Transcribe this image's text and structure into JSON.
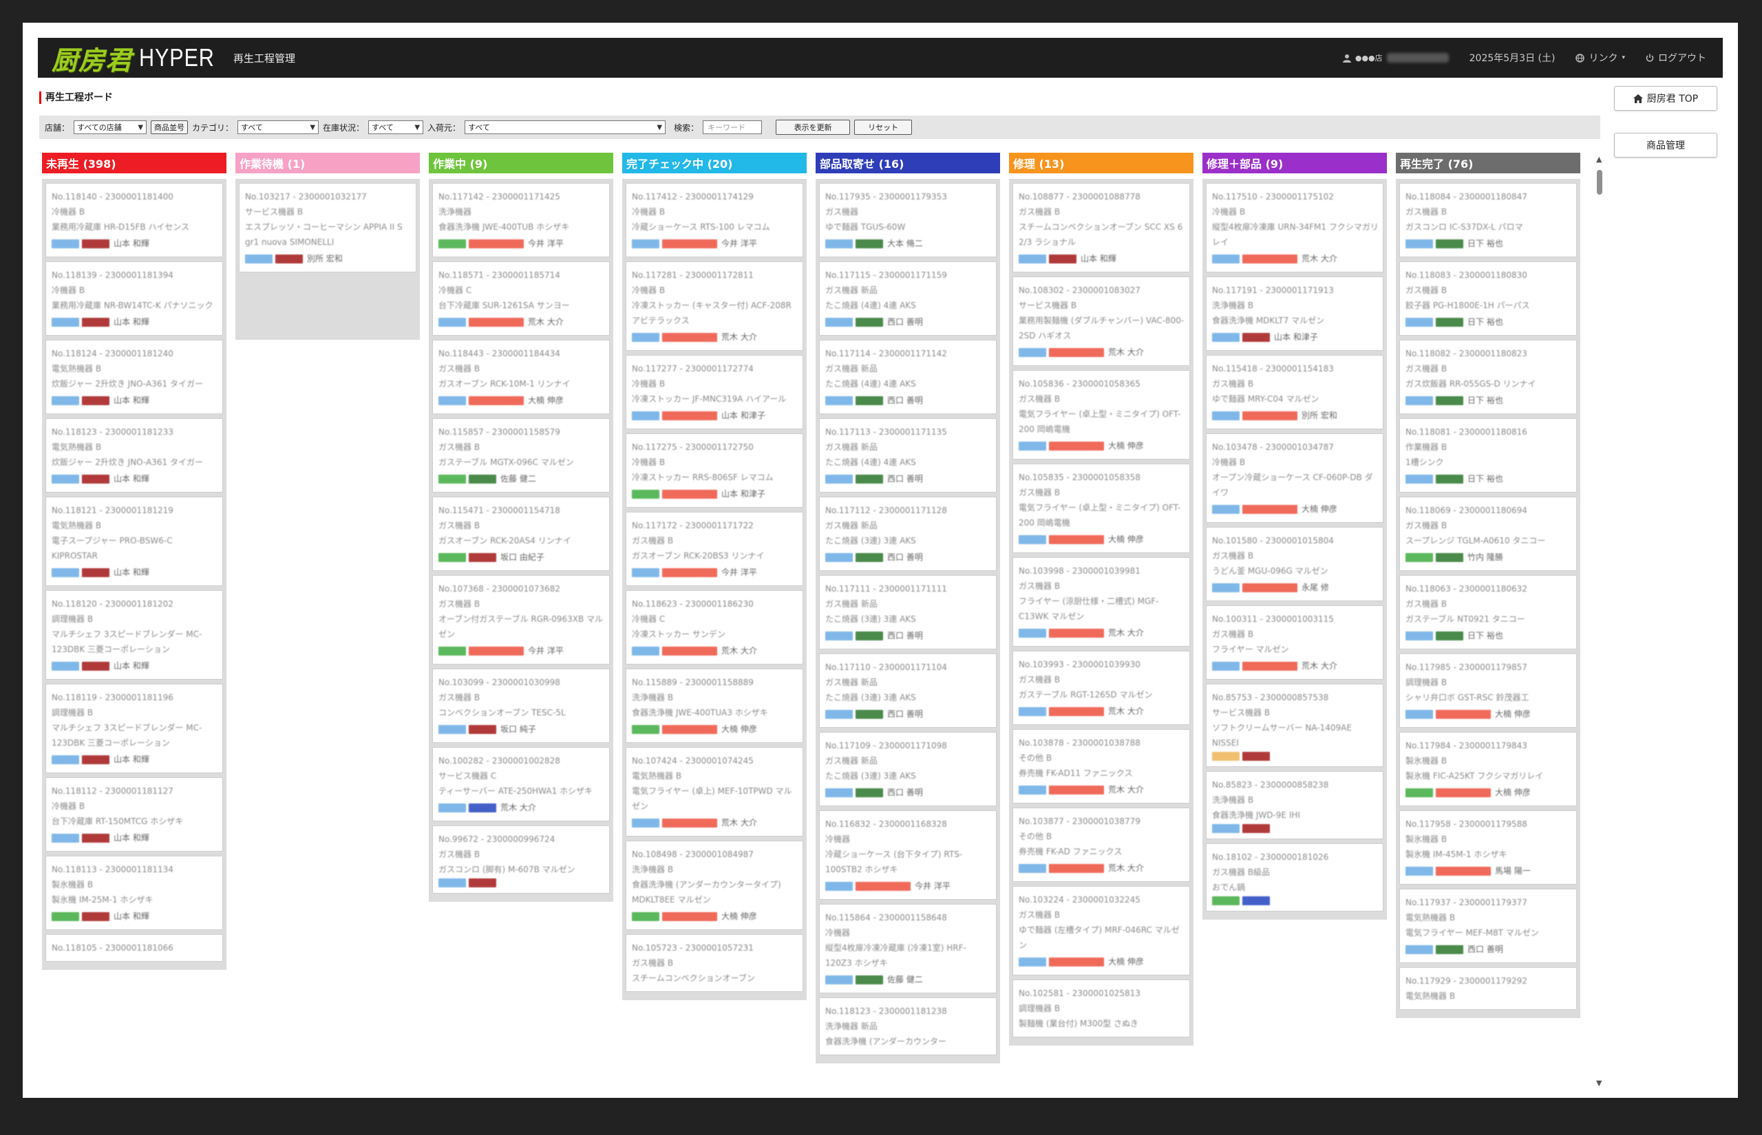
{
  "header": {
    "logo_mark": "厨房君",
    "logo_hyper": "HYPER",
    "app_title": "再生工程管理",
    "user_store": "●●●店",
    "date": "2025年5月3日 (土)",
    "link_label": "リンク",
    "logout_label": "ログアウト",
    "bg_color": "#1e1e1e",
    "logo_color": "#9ccc20"
  },
  "page_title": "再生工程ボード",
  "side_buttons": {
    "top_label": "厨房君 TOP",
    "products_label": "商品管理"
  },
  "filters": {
    "store_label": "店舗：",
    "store_value": "すべての店舗",
    "product_order_button": "商品並号",
    "category_label": "カテゴリ：",
    "category_value": "すべて",
    "stock_label": "在庫状況：",
    "stock_value": "すべて",
    "arrival_label": "入荷元：",
    "arrival_value": "すべて",
    "search_label": "検索：",
    "search_placeholder": "キーワード",
    "apply_button": "表示を更新",
    "reset_button": "リセット"
  },
  "tag_colors": {
    "blue": "#7fb8e8",
    "red": "#b03a3a",
    "salmon": "#f06a5a",
    "green": "#5cb85c",
    "darkgreen": "#4a8a4a",
    "navy": "#4460c8",
    "orange": "#f0c070"
  },
  "columns": [
    {
      "title": "未再生 (398)",
      "color": "#ee1c24",
      "cards": [
        {
          "no": "No.118140 - 2300001181400",
          "cat": "冷機器 B",
          "name": "業務用冷蔵庫 HR-D15FB ハイセンス",
          "tags": [
            "blue",
            "red"
          ],
          "person": "山本 和輝"
        },
        {
          "no": "No.118139 - 2300001181394",
          "cat": "冷機器 B",
          "name": "業務用冷蔵庫 NR-BW14TC-K パナソニック",
          "tags": [
            "blue",
            "red"
          ],
          "person": "山本 和輝"
        },
        {
          "no": "No.118124 - 2300001181240",
          "cat": "電気熱機器 B",
          "name": "炊飯ジャー 2升炊き JNO-A361 タイガー",
          "tags": [
            "blue",
            "red"
          ],
          "person": "山本 和輝"
        },
        {
          "no": "No.118123 - 2300001181233",
          "cat": "電気熱機器 B",
          "name": "炊飯ジャー 2升炊き JNO-A361 タイガー",
          "tags": [
            "blue",
            "red"
          ],
          "person": "山本 和輝"
        },
        {
          "no": "No.118121 - 2300001181219",
          "cat": "電気熱機器 B",
          "name": "電子スープジャー PRO-BSW6-C KIPROSTAR",
          "tags": [
            "blue",
            "red"
          ],
          "person": "山本 和輝"
        },
        {
          "no": "No.118120 - 2300001181202",
          "cat": "調理機器 B",
          "name": "マルチシェフ 3スピードブレンダー MC-123DBK 三菱コーポレーション",
          "tags": [
            "blue",
            "red"
          ],
          "person": "山本 和輝"
        },
        {
          "no": "No.118119 - 2300001181196",
          "cat": "調理機器 B",
          "name": "マルチシェフ 3スピードブレンダー MC-123DBK 三菱コーポレーション",
          "tags": [
            "blue",
            "red"
          ],
          "person": "山本 和輝"
        },
        {
          "no": "No.118112 - 2300001181127",
          "cat": "冷機器 B",
          "name": "台下冷蔵庫 RT-150MTCG ホシザキ",
          "tags": [
            "blue",
            "red"
          ],
          "person": "山本 和輝"
        },
        {
          "no": "No.118113 - 2300001181134",
          "cat": "製氷機器 B",
          "name": "製氷機 IM-25M-1 ホシザキ",
          "tags": [
            "green",
            "red"
          ],
          "person": "山本 和輝"
        },
        {
          "no": "No.118105 - 2300001181066",
          "cat": "",
          "name": "",
          "tags": [],
          "person": ""
        }
      ]
    },
    {
      "title": "作業待機 (1)",
      "color": "#f7a1c4",
      "cards": [
        {
          "no": "No.103217 - 2300001032177",
          "cat": "サービス機器 B",
          "name": "エスプレッソ・コーヒーマシン APPIA II S gr1 nuova SIMONELLI",
          "tags": [
            "blue",
            "red"
          ],
          "person": "別所 宏和"
        }
      ]
    },
    {
      "title": "作業中 (9)",
      "color": "#6ec43c",
      "cards": [
        {
          "no": "No.117142 - 2300001171425",
          "cat": "洗浄機器",
          "name": "食器洗浄機 JWE-400TUB ホシザキ",
          "tags": [
            "green",
            "salmon"
          ],
          "person": "今井 洋平"
        },
        {
          "no": "No.118571 - 2300001185714",
          "cat": "冷機器 C",
          "name": "台下冷蔵庫 SUR-1261SA サンヨー",
          "tags": [
            "blue",
            "salmon"
          ],
          "person": "荒木 大介"
        },
        {
          "no": "No.118443 - 2300001184434",
          "cat": "ガス機器 B",
          "name": "ガスオーブン RCK-10M-1 リンナイ",
          "tags": [
            "blue",
            "salmon"
          ],
          "person": "大楠 伸彦"
        },
        {
          "no": "No.115857 - 2300001158579",
          "cat": "ガス機器 B",
          "name": "ガステーブル MGTX-096C マルゼン",
          "tags": [
            "green",
            "darkgreen"
          ],
          "person": "佐藤 健二"
        },
        {
          "no": "No.115471 - 2300001154718",
          "cat": "ガス機器 B",
          "name": "ガスオーブン RCK-20AS4 リンナイ",
          "tags": [
            "green",
            "red"
          ],
          "person": "坂口 由紀子"
        },
        {
          "no": "No.107368 - 2300001073682",
          "cat": "ガス機器 B",
          "name": "オーブン付ガステーブル RGR-0963XB マルゼン",
          "tags": [
            "green",
            "salmon"
          ],
          "person": "今井 洋平"
        },
        {
          "no": "No.103099 - 2300001030998",
          "cat": "ガス機器 B",
          "name": "コンベクションオーブン TESC-5L",
          "tags": [
            "blue",
            "red"
          ],
          "person": "坂口 純子"
        },
        {
          "no": "No.100282 - 2300001002828",
          "cat": "サービス機器 C",
          "name": "ティーサーバー ATE-250HWA1 ホシザキ",
          "tags": [
            "blue",
            "navy"
          ],
          "person": "荒木 大介"
        },
        {
          "no": "No.99672 - 2300000996724",
          "cat": "ガス機器 B",
          "name": "ガスコンロ (脚有) M-607B マルゼン",
          "tags": [
            "blue",
            "red"
          ],
          "person": ""
        }
      ]
    },
    {
      "title": "完了チェック中 (20)",
      "color": "#22b8e8",
      "cards": [
        {
          "no": "No.117412 - 2300001174129",
          "cat": "冷機器 B",
          "name": "冷蔵ショーケース RTS-100 レマコム",
          "tags": [
            "blue",
            "salmon"
          ],
          "person": "今井 洋平"
        },
        {
          "no": "No.117281 - 2300001172811",
          "cat": "冷機器 B",
          "name": "冷凍ストッカー (キャスター付) ACF-208R アビテラックス",
          "tags": [
            "blue",
            "salmon"
          ],
          "person": "荒木 大介"
        },
        {
          "no": "No.117277 - 2300001172774",
          "cat": "冷機器 B",
          "name": "冷凍ストッカー JF-MNC319A ハイアール",
          "tags": [
            "blue",
            "salmon"
          ],
          "person": "山本 和津子"
        },
        {
          "no": "No.117275 - 2300001172750",
          "cat": "冷機器 B",
          "name": "冷凍ストッカー RRS-806SF レマコム",
          "tags": [
            "green",
            "salmon"
          ],
          "person": "山本 和津子"
        },
        {
          "no": "No.117172 - 2300001171722",
          "cat": "ガス機器 B",
          "name": "ガスオーブン RCK-20BS3 リンナイ",
          "tags": [
            "blue",
            "salmon"
          ],
          "person": "今井 洋平"
        },
        {
          "no": "No.118623 - 2300001186230",
          "cat": "冷機器 C",
          "name": "冷凍ストッカー サンデン",
          "tags": [
            "blue",
            "salmon"
          ],
          "person": "荒木 大介"
        },
        {
          "no": "No.115889 - 2300001158889",
          "cat": "洗浄機器 B",
          "name": "食器洗浄機 JWE-400TUA3 ホシザキ",
          "tags": [
            "green",
            "salmon"
          ],
          "person": "大楠 伸彦"
        },
        {
          "no": "No.107424 - 2300001074245",
          "cat": "電気熱機器 B",
          "name": "電気フライヤー (卓上) MEF-10TPWD マルゼン",
          "tags": [
            "blue",
            "salmon"
          ],
          "person": "荒木 大介"
        },
        {
          "no": "No.108498 - 2300001084987",
          "cat": "洗浄機器 B",
          "name": "食器洗浄機 (アンダーカウンタータイプ) MDKLT8EE マルゼン",
          "tags": [
            "green",
            "salmon"
          ],
          "person": "大楠 伸彦"
        },
        {
          "no": "No.105723 - 2300001057231",
          "cat": "ガス機器 B",
          "name": "スチームコンベクションオーブン",
          "tags": [],
          "person": ""
        }
      ]
    },
    {
      "title": "部品取寄せ (16)",
      "color": "#2e3db8",
      "cards": [
        {
          "no": "No.117935 - 2300001179353",
          "cat": "ガス機器",
          "name": "ゆで麺器 TGUS-60W",
          "tags": [
            "blue",
            "darkgreen"
          ],
          "person": "大本 脩二"
        },
        {
          "no": "No.117115 - 2300001171159",
          "cat": "ガス機器 新品",
          "name": "たこ焼器 (4連) 4連 AKS",
          "tags": [
            "blue",
            "darkgreen"
          ],
          "person": "西口 善明"
        },
        {
          "no": "No.117114 - 2300001171142",
          "cat": "ガス機器 新品",
          "name": "たこ焼器 (4連) 4連 AKS",
          "tags": [
            "blue",
            "darkgreen"
          ],
          "person": "西口 善明"
        },
        {
          "no": "No.117113 - 2300001171135",
          "cat": "ガス機器 新品",
          "name": "たこ焼器 (4連) 4連 AKS",
          "tags": [
            "blue",
            "darkgreen"
          ],
          "person": "西口 善明"
        },
        {
          "no": "No.117112 - 2300001171128",
          "cat": "ガス機器 新品",
          "name": "たこ焼器 (3連) 3連 AKS",
          "tags": [
            "blue",
            "darkgreen"
          ],
          "person": "西口 善明"
        },
        {
          "no": "No.117111 - 2300001171111",
          "cat": "ガス機器 新品",
          "name": "たこ焼器 (3連) 3連 AKS",
          "tags": [
            "blue",
            "darkgreen"
          ],
          "person": "西口 善明"
        },
        {
          "no": "No.117110 - 2300001171104",
          "cat": "ガス機器 新品",
          "name": "たこ焼器 (3連) 3連 AKS",
          "tags": [
            "blue",
            "darkgreen"
          ],
          "person": "西口 善明"
        },
        {
          "no": "No.117109 - 2300001171098",
          "cat": "ガス機器 新品",
          "name": "たこ焼器 (3連) 3連 AKS",
          "tags": [
            "blue",
            "darkgreen"
          ],
          "person": "西口 善明"
        },
        {
          "no": "No.116832 - 2300001168328",
          "cat": "冷機器",
          "name": "冷蔵ショーケース (台下タイプ) RTS-100STB2 ホシザキ",
          "tags": [
            "blue",
            "salmon"
          ],
          "person": "今井 洋平"
        },
        {
          "no": "No.115864 - 2300001158648",
          "cat": "冷機器",
          "name": "縦型4枚扉冷凍冷蔵庫 (冷凍1室) HRF-120Z3 ホシザキ",
          "tags": [
            "blue",
            "darkgreen"
          ],
          "person": "佐藤 健二"
        },
        {
          "no": "No.118123 - 2300001181238",
          "cat": "洗浄機器 新品",
          "name": "食器洗浄機 (アンダーカウンター",
          "tags": [],
          "person": ""
        }
      ]
    },
    {
      "title": "修理 (13)",
      "color": "#f7941d",
      "cards": [
        {
          "no": "No.108877 - 2300001088778",
          "cat": "ガス機器 B",
          "name": "スチームコンベクションオーブン SCC XS 6 2/3 ラショナル",
          "tags": [
            "blue",
            "red"
          ],
          "person": "山本 和輝"
        },
        {
          "no": "No.108302 - 2300001083027",
          "cat": "サービス機器 B",
          "name": "業務用製麺機 (ダブルチャンバー) VAC-800-2SD ハギオス",
          "tags": [
            "blue",
            "salmon"
          ],
          "person": "荒木 大介"
        },
        {
          "no": "No.105836 - 2300001058365",
          "cat": "ガス機器 B",
          "name": "電気フライヤー (卓上型・ミニタイプ) OFT-200 岡嶋電機",
          "tags": [
            "blue",
            "salmon"
          ],
          "person": "大楠 伸彦"
        },
        {
          "no": "No.105835 - 2300001058358",
          "cat": "ガス機器 B",
          "name": "電気フライヤー (卓上型・ミニタイプ) OFT-200 岡嶋電機",
          "tags": [
            "blue",
            "salmon"
          ],
          "person": "大楠 伸彦"
        },
        {
          "no": "No.103998 - 2300001039981",
          "cat": "ガス機器 B",
          "name": "フライヤー (涼厨仕様・二槽式) MGF-C13WK マルゼン",
          "tags": [
            "blue",
            "salmon"
          ],
          "person": "荒木 大介"
        },
        {
          "no": "No.103993 - 2300001039930",
          "cat": "ガス機器 B",
          "name": "ガステーブル RGT-1265D マルゼン",
          "tags": [
            "blue",
            "salmon"
          ],
          "person": "荒木 大介"
        },
        {
          "no": "No.103878 - 2300001038788",
          "cat": "その他 B",
          "name": "券売機 FK-AD11 ファニックス",
          "tags": [
            "blue",
            "salmon"
          ],
          "person": "荒木 大介"
        },
        {
          "no": "No.103877 - 2300001038779",
          "cat": "その他 B",
          "name": "券売機 FK-AD ファニックス",
          "tags": [
            "blue",
            "salmon"
          ],
          "person": "荒木 大介"
        },
        {
          "no": "No.103224 - 2300001032245",
          "cat": "ガス機器 B",
          "name": "ゆで麺器 (左槽タイプ) MRF-046RC マルゼン",
          "tags": [
            "blue",
            "salmon"
          ],
          "person": "大楠 伸彦"
        },
        {
          "no": "No.102581 - 2300001025813",
          "cat": "調理機器 B",
          "name": "製麺機 (業台付) M300型 さぬき",
          "tags": [],
          "person": ""
        }
      ]
    },
    {
      "title": "修理＋部品 (9)",
      "color": "#9b2fc9",
      "cards": [
        {
          "no": "No.117510 - 2300001175102",
          "cat": "冷機器 B",
          "name": "縦型4枚扉冷凍庫 URN-34FM1 フクシマガリレイ",
          "tags": [
            "blue",
            "salmon"
          ],
          "person": "荒木 大介"
        },
        {
          "no": "No.117191 - 2300001171913",
          "cat": "洗浄機器 B",
          "name": "食器洗浄機 MDKLT7 マルゼン",
          "tags": [
            "blue",
            "red"
          ],
          "person": "山本 和津子"
        },
        {
          "no": "No.115418 - 2300001154183",
          "cat": "ガス機器 B",
          "name": "ゆで麺器 MRY-C04 マルゼン",
          "tags": [
            "blue",
            "salmon"
          ],
          "person": "別所 宏和"
        },
        {
          "no": "No.103478 - 2300001034787",
          "cat": "冷機器 B",
          "name": "オープン冷蔵ショーケース CF-060P-DB ダイワ",
          "tags": [
            "blue",
            "salmon"
          ],
          "person": "大楠 伸彦"
        },
        {
          "no": "No.101580 - 2300001015804",
          "cat": "ガス機器 B",
          "name": "うどん釜 MGU-096G マルゼン",
          "tags": [
            "blue",
            "salmon"
          ],
          "person": "永尾 修"
        },
        {
          "no": "No.100311 - 2300001003115",
          "cat": "ガス機器 B",
          "name": "フライヤー マルゼン",
          "tags": [
            "blue",
            "salmon"
          ],
          "person": "荒木 大介"
        },
        {
          "no": "No.85753 - 2300000857538",
          "cat": "サービス機器 B",
          "name": "ソフトクリームサーバー NA-1409AE NISSEI",
          "tags": [
            "orange",
            "red"
          ],
          "person": ""
        },
        {
          "no": "No.85823 - 2300000858238",
          "cat": "洗浄機器 B",
          "name": "食器洗浄機 JWD-9E IHI",
          "tags": [
            "blue",
            "red"
          ],
          "person": ""
        },
        {
          "no": "No.18102 - 2300000181026",
          "cat": "ガス機器 B級品",
          "name": "おでん鍋",
          "tags": [
            "green",
            "navy"
          ],
          "person": ""
        }
      ]
    },
    {
      "title": "再生完了 (76)",
      "color": "#6d6d6d",
      "cards": [
        {
          "no": "No.118084 - 2300001180847",
          "cat": "ガス機器 B",
          "name": "ガスコンロ IC-S37DX-L パロマ",
          "tags": [
            "blue",
            "darkgreen"
          ],
          "person": "日下 裕也"
        },
        {
          "no": "No.118083 - 2300001180830",
          "cat": "ガス機器 B",
          "name": "餃子器 PG-H1800E-1H パーパス",
          "tags": [
            "blue",
            "darkgreen"
          ],
          "person": "日下 裕也"
        },
        {
          "no": "No.118082 - 2300001180823",
          "cat": "ガス機器 B",
          "name": "ガス炊飯器 RR-055GS-D リンナイ",
          "tags": [
            "blue",
            "darkgreen"
          ],
          "person": "日下 裕也"
        },
        {
          "no": "No.118081 - 2300001180816",
          "cat": "作業機器 B",
          "name": "1槽シンク",
          "tags": [
            "blue",
            "darkgreen"
          ],
          "person": "日下 裕也"
        },
        {
          "no": "No.118069 - 2300001180694",
          "cat": "ガス機器 B",
          "name": "スープレンジ TGLM-A0610 タニコー",
          "tags": [
            "green",
            "darkgreen"
          ],
          "person": "竹内 隆勝"
        },
        {
          "no": "No.118063 - 2300001180632",
          "cat": "ガス機器 B",
          "name": "ガステーブル NT0921 タニコー",
          "tags": [
            "blue",
            "darkgreen"
          ],
          "person": "日下 裕也"
        },
        {
          "no": "No.117985 - 2300001179857",
          "cat": "調理機器 B",
          "name": "シャリ弁口ボ GST-RSC 鈴茂器工",
          "tags": [
            "blue",
            "salmon"
          ],
          "person": "大楠 伸彦"
        },
        {
          "no": "No.117984 - 2300001179843",
          "cat": "製氷機器 B",
          "name": "製氷機 FIC-A25KT フクシマガリレイ",
          "tags": [
            "green",
            "salmon"
          ],
          "person": "大楠 伸彦"
        },
        {
          "no": "No.117958 - 2300001179588",
          "cat": "製氷機器 B",
          "name": "製氷機 IM-45M-1 ホシザキ",
          "tags": [
            "blue",
            "salmon"
          ],
          "person": "馬場 陽一"
        },
        {
          "no": "No.117937 - 2300001179377",
          "cat": "電気熱機器 B",
          "name": "電気フライヤー MEF-M8T マルゼン",
          "tags": [
            "blue",
            "darkgreen"
          ],
          "person": "西口 善明"
        },
        {
          "no": "No.117929 - 2300001179292",
          "cat": "電気熱機器 B",
          "name": "",
          "tags": [],
          "person": ""
        }
      ]
    }
  ]
}
